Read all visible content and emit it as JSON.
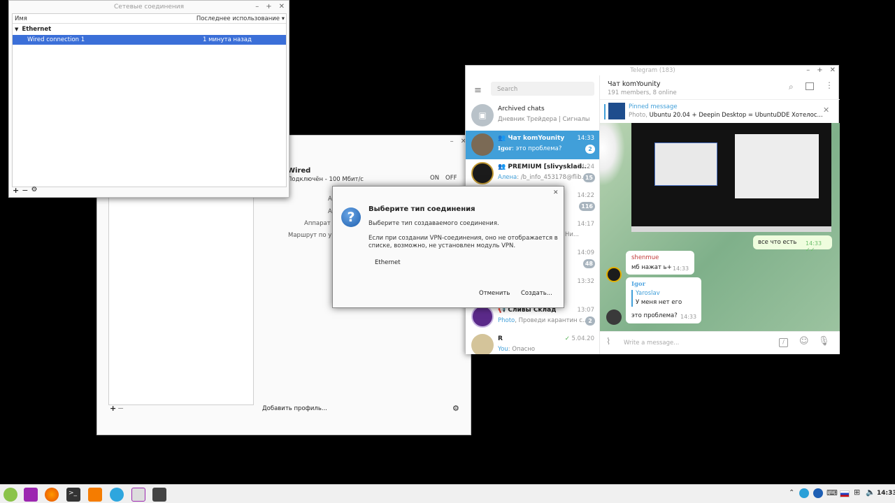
{
  "network_window": {
    "title": "Сетевые соединения",
    "col_name": "Имя",
    "col_last_used": "Последнее использование",
    "group": "Ethernet",
    "connection_name": "Wired connection 1",
    "connection_time": "1 минута назад",
    "add": "+",
    "remove": "−"
  },
  "settings_window": {
    "device_title": "Wired",
    "device_status": "Подключён - 100 Мбит/с",
    "on_label": "ON",
    "off_label": "OFF",
    "label_a1": "А",
    "label_a2": "А",
    "label_hw": "Аппарат",
    "label_route": "Маршрут по ум",
    "add_profile": "Добавить профиль...",
    "add": "+",
    "remove": "−"
  },
  "dialog": {
    "title": "Выберите тип соединения",
    "subtitle": "Выберите тип создаваемого соединения.",
    "note": "Если при создании VPN-соединения, оно не отображается в списке, возможно, не установлен модуль VPN.",
    "option": "Ethernet",
    "cancel": "Отменить",
    "create": "Создать..."
  },
  "telegram": {
    "window_title": "Telegram (183)",
    "search_placeholder": "Search",
    "archived_title": "Archived chats",
    "archived_sub": "Дневник Трейдера | Сигналы",
    "chats": [
      {
        "name": "Чат komYounity",
        "sender": "Igor",
        "msg": ": это проблема?",
        "time": "14:33",
        "badge": "2"
      },
      {
        "name": "PREMIUM [slivysklad...",
        "sender": "Алена",
        "msg": ": /b_info_453178@flib...",
        "time": "14:24",
        "badge": "15"
      },
      {
        "name": "",
        "sender": "",
        "msg": "",
        "time": "14:22",
        "badge": "116"
      },
      {
        "name": "",
        "sender": "",
        "msg": "5459. Ни...",
        "time": "14:17",
        "badge": ""
      },
      {
        "name": "",
        "sender": "",
        "msg": "",
        "time": "14:09",
        "badge": "48"
      },
      {
        "name": "",
        "sender": "",
        "msg": "",
        "time": "13:32",
        "badge": ""
      },
      {
        "name": "Сливы Склад",
        "sender": "Photo",
        "msg": ", Проведи карантин с...",
        "time": "13:07",
        "badge": "2"
      },
      {
        "name": "R",
        "sender": "You",
        "msg": ": Опасно",
        "time": "5.04.20",
        "badge": ""
      }
    ],
    "chat_title": "Чат komYounity",
    "chat_sub": "191 members, 8 online",
    "pinned_label": "Pinned message",
    "pinned_prefix": "Photo,",
    "pinned_text": " Ubuntu 20.04 + Deepin Desktop = UbuntuDDE  Хотелос...",
    "msg_out_text": "все что есть",
    "msg_out_time": "14:33",
    "msg1_sender": "shenmue",
    "msg1_text": "мб нажат ь+",
    "msg1_time": "14:33",
    "msg2_sender": "Igor",
    "msg2_reply_name": "Yaroslav",
    "msg2_reply_text": "У меня нет его",
    "msg2_text": "это проблема?",
    "msg2_time": "14:33",
    "compose_placeholder": "Write a message..."
  },
  "taskbar": {
    "clock": "14:33"
  }
}
